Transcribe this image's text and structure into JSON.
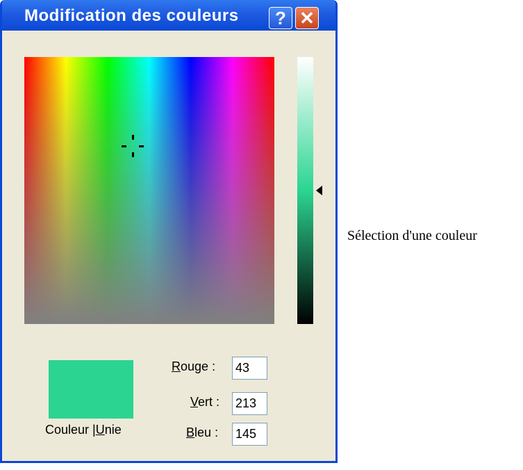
{
  "window": {
    "title": "Modification des couleurs",
    "help_label": "?",
    "close_label": "✕"
  },
  "color": {
    "hex": "#2bd591",
    "solid_label_prefix": "Couleur |",
    "solid_label_mnemonic": "U",
    "solid_label_suffix": "nie",
    "fields": [
      {
        "mnemonic": "R",
        "rest": "ouge",
        "colon": ":",
        "value": "43"
      },
      {
        "mnemonic": "V",
        "rest": "ert",
        "colon": ":",
        "value": "213"
      },
      {
        "mnemonic": "B",
        "rest": "leu",
        "colon": ":",
        "value": "145"
      }
    ]
  },
  "caption": "Sélection d'une couleur"
}
